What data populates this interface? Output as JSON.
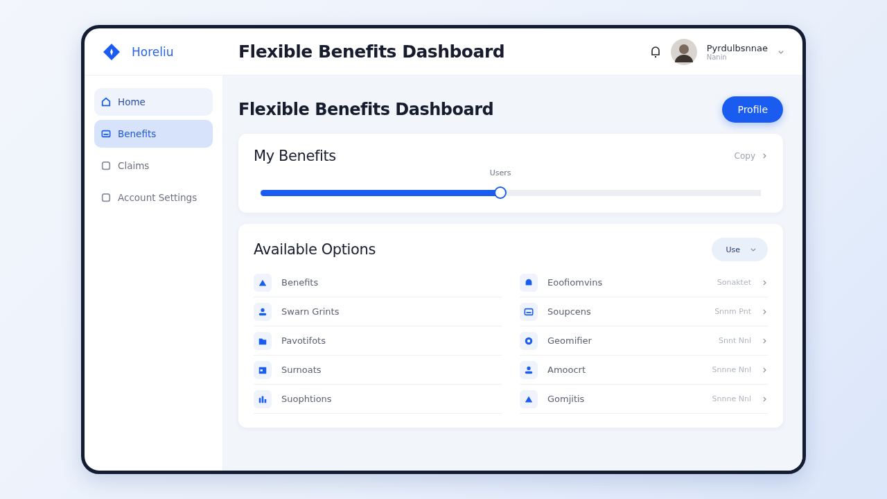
{
  "brand": {
    "name": "Horeliu"
  },
  "header": {
    "title": "Flexible Benefits Dashboard",
    "user": {
      "name": "Pyrdulbsnnae",
      "role": "Nanin"
    }
  },
  "sidebar": {
    "items": [
      {
        "label": "Home",
        "kind": "home",
        "selected": false,
        "highlighted": true
      },
      {
        "label": "Benefits",
        "kind": "card",
        "selected": true,
        "highlighted": false
      },
      {
        "label": "Claims",
        "kind": "doc",
        "selected": false,
        "highlighted": false
      },
      {
        "label": "Account Settings",
        "kind": "doc",
        "selected": false,
        "highlighted": false
      }
    ]
  },
  "page": {
    "title": "Flexible Benefits Dashboard",
    "action": "Profile"
  },
  "my_benefits": {
    "title": "My Benefits",
    "link": "Copy",
    "slider": {
      "label": "Users",
      "level": 0.48
    }
  },
  "options": {
    "title": "Available Options",
    "filter": "Use",
    "left": [
      {
        "label": "Benefits",
        "kind": "triangle"
      },
      {
        "label": "Swarn Grints",
        "kind": "person"
      },
      {
        "label": "Pavotifots",
        "kind": "folder"
      },
      {
        "label": "Surnoats",
        "kind": "calendar"
      },
      {
        "label": "Suophtions",
        "kind": "chart"
      }
    ],
    "right": [
      {
        "label": "Eoofiomvins",
        "kind": "bell",
        "meta": "Sonaktet"
      },
      {
        "label": "Soupcens",
        "kind": "card",
        "meta": "Snnm Pnt"
      },
      {
        "label": "Geomifier",
        "kind": "circle",
        "meta": "Snnt Nnl"
      },
      {
        "label": "Amoocrt",
        "kind": "person",
        "meta": "Snnne Nnl"
      },
      {
        "label": "Gomjitis",
        "kind": "triangle",
        "meta": "Snnne Nnl"
      }
    ]
  }
}
